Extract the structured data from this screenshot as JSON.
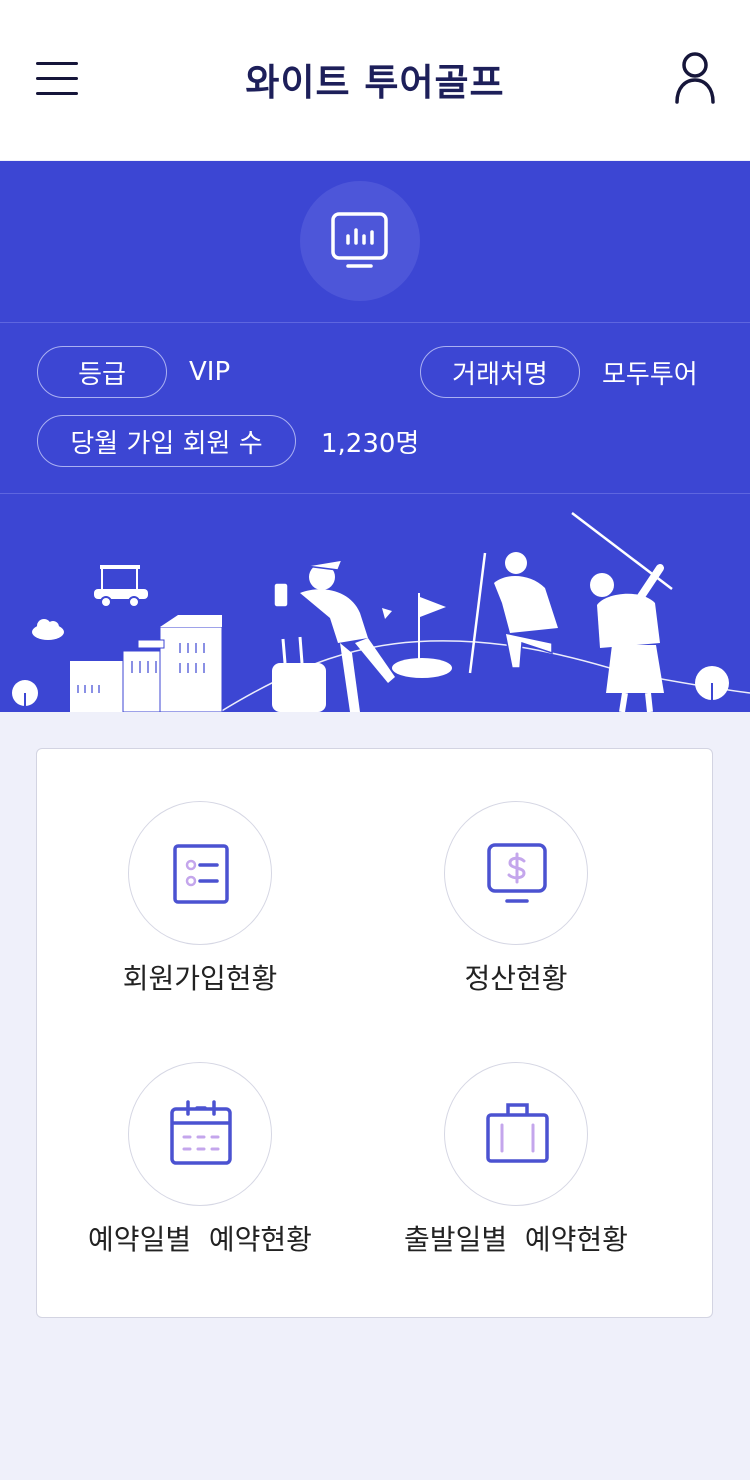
{
  "header": {
    "title": "와이트 투어골프",
    "menu_icon": "hamburger-menu-icon",
    "user_icon": "user-profile-icon"
  },
  "summary": {
    "icon": "chart-monitor-icon",
    "grade_label": "등급",
    "grade_value": "VIP",
    "partner_label": "거래처명",
    "partner_value": "모두투어",
    "monthly_members_label": "당월 가입 회원 수",
    "monthly_members_value": "1,230명"
  },
  "menu": {
    "items": [
      {
        "label": "회원가입현황",
        "icon": "member-list-icon"
      },
      {
        "label": "정산현황",
        "icon": "dollar-monitor-icon"
      },
      {
        "label": "예약일별  예약현황",
        "icon": "calendar-icon"
      },
      {
        "label": "출발일별  예약현황",
        "icon": "suitcase-icon"
      }
    ]
  },
  "colors": {
    "primary": "#3c46d3",
    "accent_icon": "#4b52d1",
    "accent_light": "#c4a6ec",
    "background": "#eff0fa"
  }
}
